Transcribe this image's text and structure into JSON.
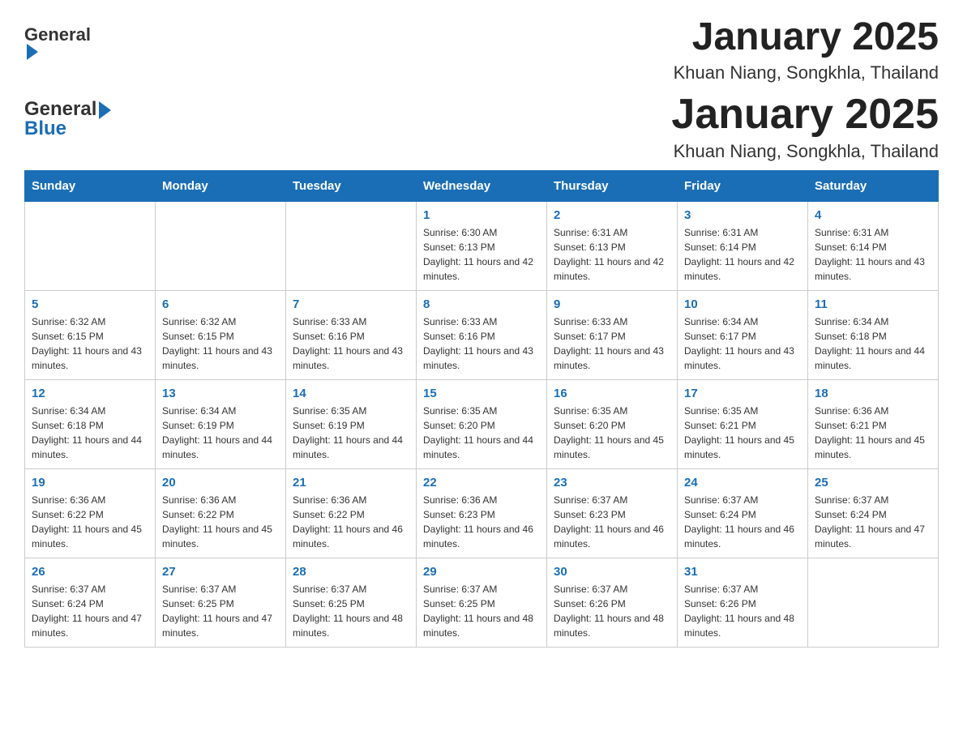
{
  "header": {
    "logo_general": "General",
    "logo_blue": "Blue",
    "month_title": "January 2025",
    "location": "Khuan Niang, Songkhla, Thailand"
  },
  "days_of_week": [
    "Sunday",
    "Monday",
    "Tuesday",
    "Wednesday",
    "Thursday",
    "Friday",
    "Saturday"
  ],
  "weeks": [
    [
      {
        "day": "",
        "info": ""
      },
      {
        "day": "",
        "info": ""
      },
      {
        "day": "",
        "info": ""
      },
      {
        "day": "1",
        "info": "Sunrise: 6:30 AM\nSunset: 6:13 PM\nDaylight: 11 hours and 42 minutes."
      },
      {
        "day": "2",
        "info": "Sunrise: 6:31 AM\nSunset: 6:13 PM\nDaylight: 11 hours and 42 minutes."
      },
      {
        "day": "3",
        "info": "Sunrise: 6:31 AM\nSunset: 6:14 PM\nDaylight: 11 hours and 42 minutes."
      },
      {
        "day": "4",
        "info": "Sunrise: 6:31 AM\nSunset: 6:14 PM\nDaylight: 11 hours and 43 minutes."
      }
    ],
    [
      {
        "day": "5",
        "info": "Sunrise: 6:32 AM\nSunset: 6:15 PM\nDaylight: 11 hours and 43 minutes."
      },
      {
        "day": "6",
        "info": "Sunrise: 6:32 AM\nSunset: 6:15 PM\nDaylight: 11 hours and 43 minutes."
      },
      {
        "day": "7",
        "info": "Sunrise: 6:33 AM\nSunset: 6:16 PM\nDaylight: 11 hours and 43 minutes."
      },
      {
        "day": "8",
        "info": "Sunrise: 6:33 AM\nSunset: 6:16 PM\nDaylight: 11 hours and 43 minutes."
      },
      {
        "day": "9",
        "info": "Sunrise: 6:33 AM\nSunset: 6:17 PM\nDaylight: 11 hours and 43 minutes."
      },
      {
        "day": "10",
        "info": "Sunrise: 6:34 AM\nSunset: 6:17 PM\nDaylight: 11 hours and 43 minutes."
      },
      {
        "day": "11",
        "info": "Sunrise: 6:34 AM\nSunset: 6:18 PM\nDaylight: 11 hours and 44 minutes."
      }
    ],
    [
      {
        "day": "12",
        "info": "Sunrise: 6:34 AM\nSunset: 6:18 PM\nDaylight: 11 hours and 44 minutes."
      },
      {
        "day": "13",
        "info": "Sunrise: 6:34 AM\nSunset: 6:19 PM\nDaylight: 11 hours and 44 minutes."
      },
      {
        "day": "14",
        "info": "Sunrise: 6:35 AM\nSunset: 6:19 PM\nDaylight: 11 hours and 44 minutes."
      },
      {
        "day": "15",
        "info": "Sunrise: 6:35 AM\nSunset: 6:20 PM\nDaylight: 11 hours and 44 minutes."
      },
      {
        "day": "16",
        "info": "Sunrise: 6:35 AM\nSunset: 6:20 PM\nDaylight: 11 hours and 45 minutes."
      },
      {
        "day": "17",
        "info": "Sunrise: 6:35 AM\nSunset: 6:21 PM\nDaylight: 11 hours and 45 minutes."
      },
      {
        "day": "18",
        "info": "Sunrise: 6:36 AM\nSunset: 6:21 PM\nDaylight: 11 hours and 45 minutes."
      }
    ],
    [
      {
        "day": "19",
        "info": "Sunrise: 6:36 AM\nSunset: 6:22 PM\nDaylight: 11 hours and 45 minutes."
      },
      {
        "day": "20",
        "info": "Sunrise: 6:36 AM\nSunset: 6:22 PM\nDaylight: 11 hours and 45 minutes."
      },
      {
        "day": "21",
        "info": "Sunrise: 6:36 AM\nSunset: 6:22 PM\nDaylight: 11 hours and 46 minutes."
      },
      {
        "day": "22",
        "info": "Sunrise: 6:36 AM\nSunset: 6:23 PM\nDaylight: 11 hours and 46 minutes."
      },
      {
        "day": "23",
        "info": "Sunrise: 6:37 AM\nSunset: 6:23 PM\nDaylight: 11 hours and 46 minutes."
      },
      {
        "day": "24",
        "info": "Sunrise: 6:37 AM\nSunset: 6:24 PM\nDaylight: 11 hours and 46 minutes."
      },
      {
        "day": "25",
        "info": "Sunrise: 6:37 AM\nSunset: 6:24 PM\nDaylight: 11 hours and 47 minutes."
      }
    ],
    [
      {
        "day": "26",
        "info": "Sunrise: 6:37 AM\nSunset: 6:24 PM\nDaylight: 11 hours and 47 minutes."
      },
      {
        "day": "27",
        "info": "Sunrise: 6:37 AM\nSunset: 6:25 PM\nDaylight: 11 hours and 47 minutes."
      },
      {
        "day": "28",
        "info": "Sunrise: 6:37 AM\nSunset: 6:25 PM\nDaylight: 11 hours and 48 minutes."
      },
      {
        "day": "29",
        "info": "Sunrise: 6:37 AM\nSunset: 6:25 PM\nDaylight: 11 hours and 48 minutes."
      },
      {
        "day": "30",
        "info": "Sunrise: 6:37 AM\nSunset: 6:26 PM\nDaylight: 11 hours and 48 minutes."
      },
      {
        "day": "31",
        "info": "Sunrise: 6:37 AM\nSunset: 6:26 PM\nDaylight: 11 hours and 48 minutes."
      },
      {
        "day": "",
        "info": ""
      }
    ]
  ]
}
